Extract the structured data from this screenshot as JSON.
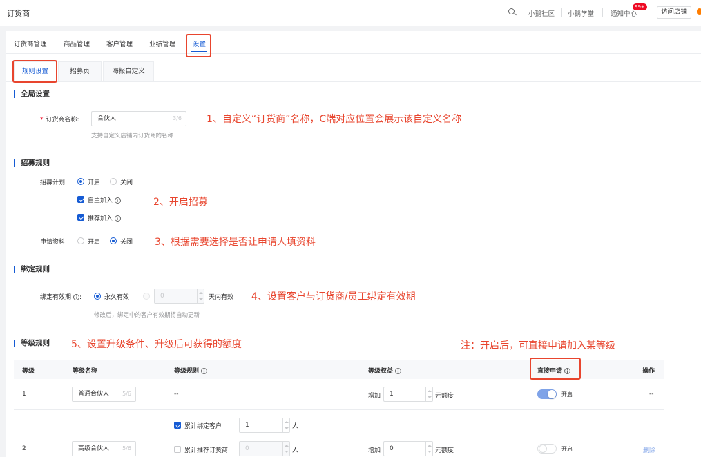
{
  "header": {
    "app_title": "订货商",
    "links": [
      "小鹅社区",
      "小鹅学堂",
      "通知中心"
    ],
    "notify_badge": "99+",
    "visit_store": "访问店铺"
  },
  "main_tabs": [
    "订货商管理",
    "商品管理",
    "客户管理",
    "业绩管理",
    "设置"
  ],
  "sub_tabs": [
    "规则设置",
    "招募页",
    "海报自定义"
  ],
  "global": {
    "title": "全局设置",
    "name_label": "订货商名称:",
    "name_value": "合伙人",
    "name_count": "3/6",
    "name_help": "支持自定义店铺内订货商的名称"
  },
  "recruit": {
    "title": "招募规则",
    "plan_label": "招募计划:",
    "on": "开启",
    "off": "关闭",
    "self_join": "自主加入",
    "recommend_join": "推荐加入",
    "apply_label": "申请资料:"
  },
  "binding": {
    "title": "绑定规则",
    "period_label": "绑定有效期",
    "permanent": "永久有效",
    "days_value": "0",
    "days_suffix": "天内有效",
    "help": "修改后，绑定中的客户有效期将自动更新"
  },
  "levels": {
    "title": "等级规则",
    "columns": [
      "等级",
      "等级名称",
      "等级规则",
      "等级权益",
      "直接申请",
      "操作"
    ],
    "rows": [
      {
        "level": "1",
        "name": "普通合伙人",
        "count": "5/6",
        "rule": "--",
        "benefit_prefix": "增加",
        "benefit_value": "1",
        "benefit_suffix": "元额度",
        "status": "开启",
        "action": "--"
      },
      {
        "level": "2",
        "name": "高级合伙人",
        "count": "5/6",
        "rule_a_label": "累计绑定客户",
        "rule_a_value": "1",
        "rule_b_label": "累计推荐订货商",
        "rule_b_value": "0",
        "unit": "人",
        "benefit_prefix": "增加",
        "benefit_value": "0",
        "benefit_suffix": "元额度",
        "status": "开启",
        "action": "删除"
      }
    ]
  },
  "annotations": {
    "a1": "1、自定义“订货商”名称，C端对应位置会展示该自定义名称",
    "a2": "2、开启招募",
    "a3": "3、根据需要选择是否让申请人填资料",
    "a4": "4、设置客户与订货商/员工绑定有效期",
    "a5": "5、设置升级条件、升级后可获得的额度",
    "note": "注：开启后，可直接申请加入某等级"
  },
  "colors": {
    "accent": "#155bd4",
    "annotation": "#e8452e"
  }
}
